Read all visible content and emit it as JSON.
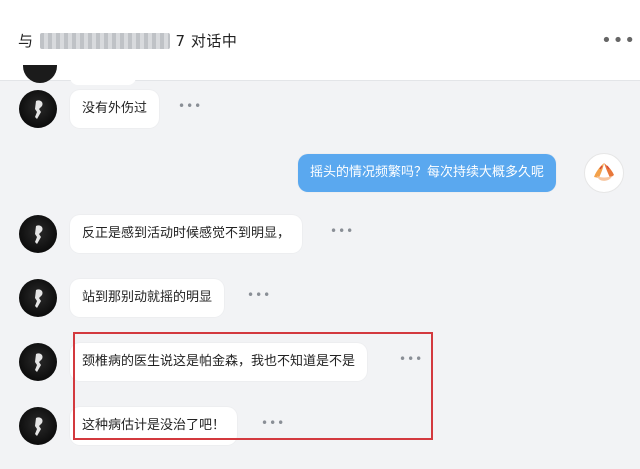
{
  "header": {
    "title_prefix": "与",
    "title_masked": "7",
    "title_suffix": "对话中",
    "more_label": "•••"
  },
  "messages": [
    {
      "from": "other",
      "text": "没有外伤过"
    },
    {
      "from": "me",
      "text": "摇头的情况频繁吗？每次持续大概多久呢"
    },
    {
      "from": "other",
      "text": "反正是感到活动时候感觉不到明显，"
    },
    {
      "from": "other",
      "text": "站到那别动就摇的明显"
    },
    {
      "from": "other",
      "text": "颈椎病的医生说这是帕金森，我也不知道是不是"
    },
    {
      "from": "other",
      "text": "这种病估计是没治了吧！"
    }
  ],
  "more_label": "•••",
  "colors": {
    "background": "#f2f3f5",
    "my_bubble": "#5aa8ef",
    "other_bubble": "#ffffff",
    "highlight": "#d3393e"
  },
  "icons": {
    "header_more": "more-dots-icon",
    "other_avatar": "user-avatar",
    "my_avatar": "hands-avatar"
  }
}
